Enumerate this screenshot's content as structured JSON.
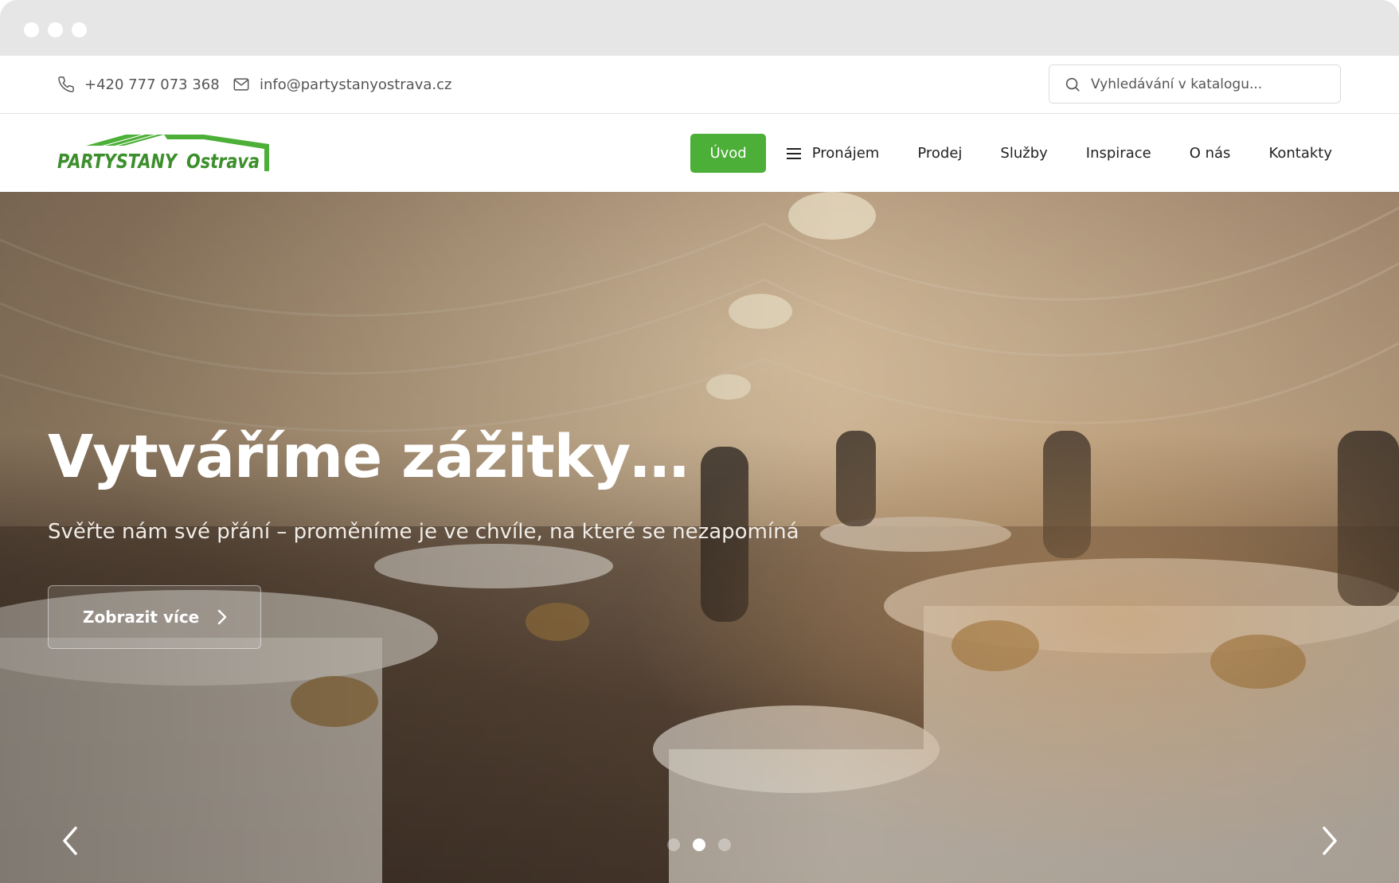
{
  "topbar": {
    "phone": "+420 777 073 368",
    "email": "info@partystanyostrava.cz",
    "search_placeholder": "Vyhledávání v katalogu..."
  },
  "logo": {
    "text_main": "PARTYSTANY",
    "text_city": "Ostrava",
    "brand_color": "#4caf37"
  },
  "nav": {
    "items": [
      {
        "label": "Úvod",
        "active": true
      },
      {
        "label": "Pronájem",
        "icon": "menu-icon"
      },
      {
        "label": "Prodej"
      },
      {
        "label": "Služby"
      },
      {
        "label": "Inspirace"
      },
      {
        "label": "O nás"
      },
      {
        "label": "Kontakty"
      }
    ]
  },
  "hero": {
    "title": "Vytváříme zážitky…",
    "subtitle": "Svěřte nám své přání – proměníme je ve chvíle, na které se nezapomíná",
    "button_label": "Zobrazit více",
    "slides_total": 3,
    "active_slide": 2
  },
  "icons": {
    "phone": "phone-icon",
    "email": "mail-icon",
    "search": "search-icon",
    "prev": "chevron-left-icon",
    "next": "chevron-right-icon"
  }
}
